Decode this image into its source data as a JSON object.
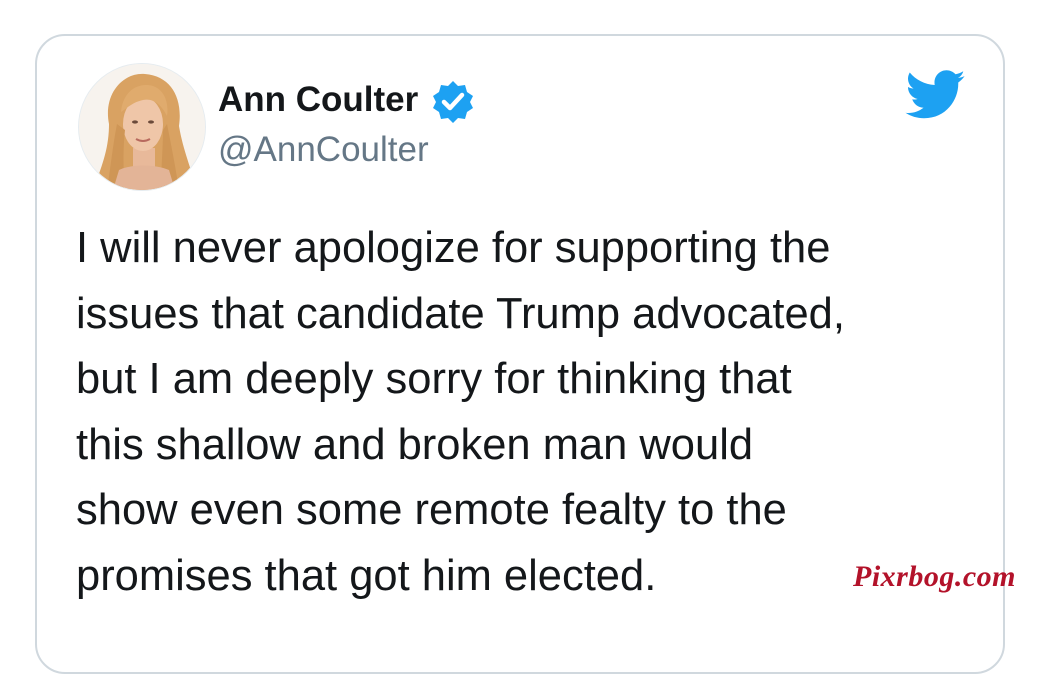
{
  "tweet": {
    "author": {
      "display_name": "Ann Coulter",
      "handle": "@AnnCoulter",
      "verified": true,
      "avatar_icon": "profile-photo"
    },
    "platform_icon": "twitter-bird-icon",
    "text_lines": [
      "I will never apologize for supporting the",
      "issues that candidate Trump advocated,",
      "but I am deeply sorry for thinking that",
      "this shallow and broken man would",
      "show even some remote fealty to the",
      "promises that got him elected."
    ]
  },
  "watermark": {
    "text": "Pixrbog.com"
  },
  "colors": {
    "twitter_blue": "#1da1f2",
    "text_primary": "#14171a",
    "text_secondary": "#657786",
    "card_border": "#d0d8de",
    "watermark": "#b3122a"
  }
}
